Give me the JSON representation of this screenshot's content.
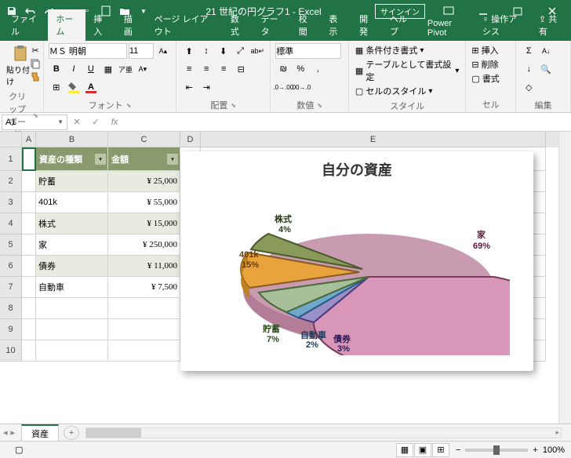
{
  "titlebar": {
    "title": "21 世紀の円グラフ1 - Excel",
    "signin": "サインイン"
  },
  "tabs": {
    "file": "ファイル",
    "home": "ホーム",
    "insert": "挿入",
    "draw": "描画",
    "layout": "ページ レイアウト",
    "formulas": "数式",
    "data": "データ",
    "review": "校閲",
    "view": "表示",
    "dev": "開発",
    "help": "ヘルプ",
    "powerpivot": "Power Pivot",
    "tellme": "操作アシス",
    "share": "共有"
  },
  "ribbon": {
    "clipboard": {
      "label": "クリップボード",
      "paste": "貼り付け"
    },
    "font": {
      "label": "フォント",
      "name": "ＭＳ 明朝",
      "size": "11"
    },
    "align": {
      "label": "配置"
    },
    "number": {
      "label": "数値",
      "format": "標準"
    },
    "styles": {
      "label": "スタイル",
      "cond": "条件付き書式",
      "tblfmt": "テーブルとして書式設定",
      "cellstyle": "セルのスタイル"
    },
    "cells": {
      "label": "セル",
      "insert": "挿入",
      "delete": "削除",
      "format": "書式"
    },
    "editing": {
      "label": "編集"
    }
  },
  "namebox": "A1",
  "columns": {
    "A": "A",
    "B": "B",
    "C": "C",
    "D": "D",
    "E": "E"
  },
  "colwidths": {
    "A": 18,
    "B": 92,
    "C": 92,
    "D": 26,
    "E": 440
  },
  "rows": [
    "1",
    "2",
    "3",
    "4",
    "5",
    "6",
    "7",
    "8",
    "9",
    "10"
  ],
  "table": {
    "headers": {
      "type": "資産の種類",
      "amount": "金額"
    },
    "rows": [
      {
        "type": "貯蓄",
        "amount": "¥  25,000"
      },
      {
        "type": "401k",
        "amount": "¥  55,000"
      },
      {
        "type": "株式",
        "amount": "¥  15,000"
      },
      {
        "type": "家",
        "amount": "¥ 250,000"
      },
      {
        "type": "債券",
        "amount": "¥  11,000"
      },
      {
        "type": "自動車",
        "amount": "¥   7,500"
      }
    ]
  },
  "chart_data": {
    "type": "pie",
    "title": "自分の資産",
    "categories": [
      "株式",
      "401k",
      "貯蓄",
      "自動車",
      "債券",
      "家"
    ],
    "values": [
      4,
      15,
      7,
      2,
      3,
      69
    ],
    "labels": [
      "株式\n4%",
      "401k\n15%",
      "貯蓄\n7%",
      "自動車\n2%",
      "債券\n3%",
      "家\n69%"
    ],
    "colors": [
      "#8a9a5b",
      "#e8a33d",
      "#a8c09a",
      "#6fa8c9",
      "#9b8fc7",
      "#d896b8"
    ]
  },
  "sheet": {
    "name": "資産"
  },
  "status": {
    "ready": "",
    "zoom": "100%"
  }
}
